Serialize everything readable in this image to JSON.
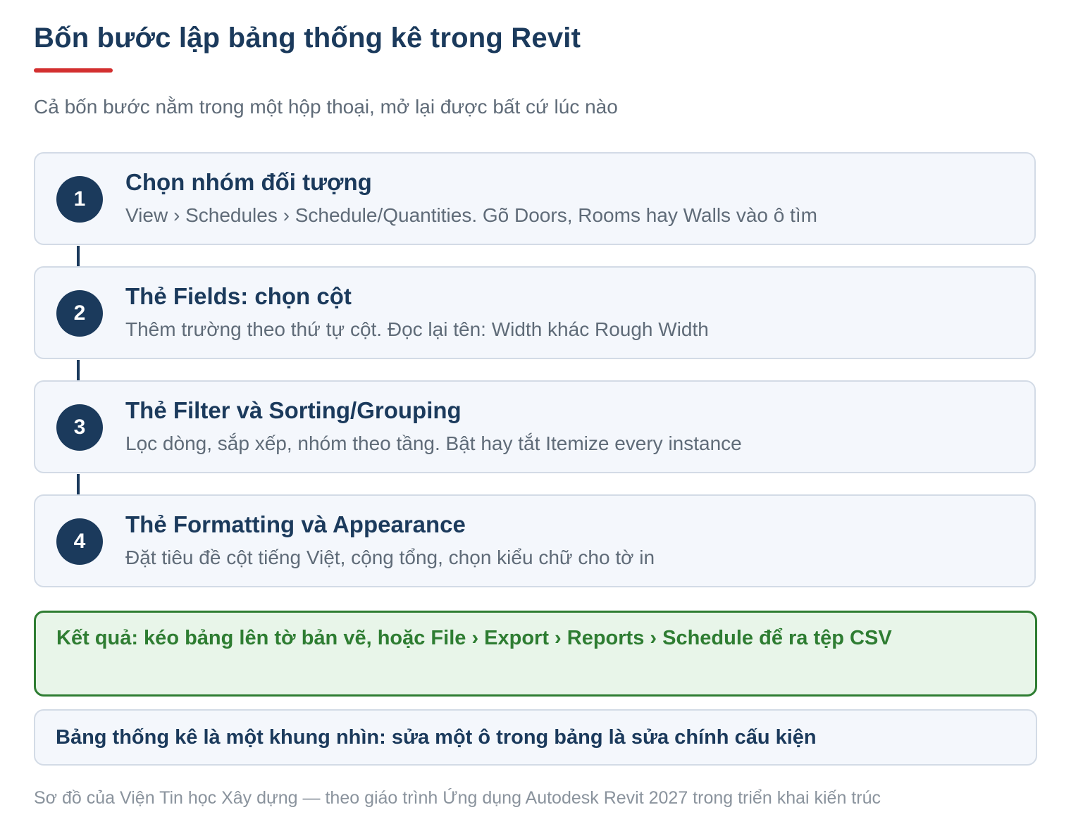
{
  "title": "Bốn bước lập bảng thống kê trong Revit",
  "subtitle": "Cả bốn bước nằm trong một hộp thoại, mở lại được bất cứ lúc nào",
  "steps": [
    {
      "number": "1",
      "title": "Chọn nhóm đối tượng",
      "description": "View › Schedules › Schedule/Quantities. Gõ Doors, Rooms hay Walls vào ô tìm"
    },
    {
      "number": "2",
      "title": "Thẻ Fields: chọn cột",
      "description": "Thêm trường theo thứ tự cột. Đọc lại tên: Width khác Rough Width"
    },
    {
      "number": "3",
      "title": "Thẻ Filter và Sorting/Grouping",
      "description": "Lọc dòng, sắp xếp, nhóm theo tầng. Bật hay tắt Itemize every instance"
    },
    {
      "number": "4",
      "title": "Thẻ Formatting và Appearance",
      "description": "Đặt tiêu đề cột tiếng Việt, cộng tổng, chọn kiểu chữ cho tờ in"
    }
  ],
  "result": "Kết quả: kéo bảng lên tờ bản vẽ, hoặc File › Export › Reports › Schedule để ra tệp CSV",
  "note": "Bảng thống kê là một khung nhìn: sửa một ô trong bảng là sửa chính cấu kiện",
  "footer": "Sơ đồ của Viện Tin học Xây dựng — theo giáo trình Ứng dụng Autodesk Revit 2027 trong triển khai kiến trúc",
  "colors": {
    "primary": "#1b3a5c",
    "accent": "#d32f2f",
    "success": "#2e7d32",
    "success_bg": "#e8f5e9",
    "card_bg": "#f4f7fc"
  }
}
